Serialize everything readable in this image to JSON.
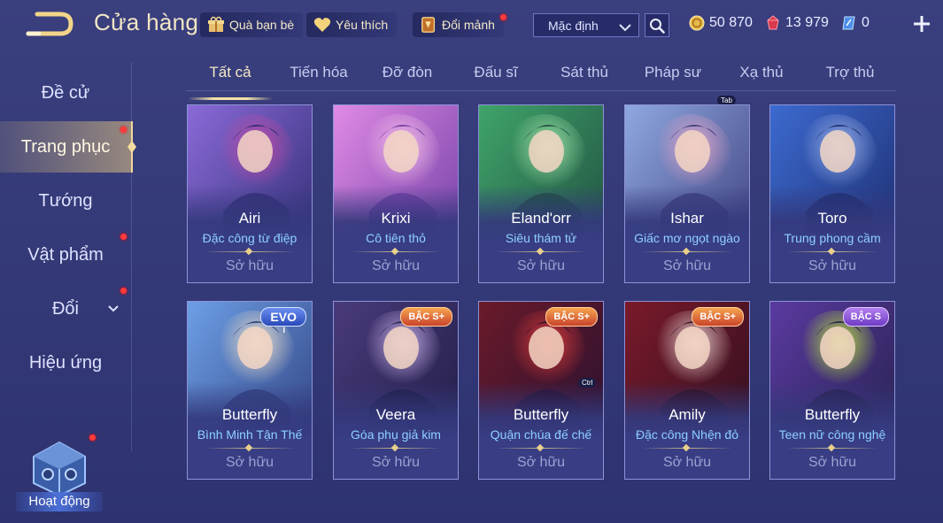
{
  "header": {
    "title": "Cửa hàng",
    "chips": [
      {
        "label": "Quà bạn bè",
        "icon": "gift-icon"
      },
      {
        "label": "Yêu thích",
        "icon": "heart-icon"
      },
      {
        "label": "Đổi mảnh",
        "icon": "shard-card-icon"
      }
    ],
    "sort": {
      "selected": "Mặc định"
    },
    "currencies": [
      {
        "icon": "gold-coin-icon",
        "value": "50 870",
        "color": "#e8b84a"
      },
      {
        "icon": "ruby-icon",
        "value": "13 979",
        "color": "#e0475a"
      },
      {
        "icon": "voucher-icon",
        "value": "0",
        "color": "#6fb7ff"
      }
    ]
  },
  "tabs": [
    {
      "label": "Tất cả",
      "active": true
    },
    {
      "label": "Tiến hóa"
    },
    {
      "label": "Đỡ đòn"
    },
    {
      "label": "Đấu sĩ"
    },
    {
      "label": "Sát thủ"
    },
    {
      "label": "Pháp sư"
    },
    {
      "label": "Xạ thủ"
    },
    {
      "label": "Trợ thủ"
    }
  ],
  "tab_key_hint": "Tab",
  "sidebar": {
    "items": [
      {
        "label": "Đề cử"
      },
      {
        "label": "Trang phục",
        "active": true,
        "dot": true
      },
      {
        "label": "Tướng"
      },
      {
        "label": "Vật phẩm",
        "dot": true
      },
      {
        "label": "Đổi",
        "dot": true
      },
      {
        "label": "Hiệu ứng"
      }
    ],
    "events_label": "Hoạt động"
  },
  "cards": [
    {
      "hero": "Airi",
      "skin": "Đặc công từ điệp",
      "status": "Sở hữu",
      "colors": [
        "#8a6ad8",
        "#c04aa6",
        "#2c2a6e"
      ]
    },
    {
      "hero": "Krixi",
      "skin": "Cô tiên thỏ",
      "status": "Sở hữu",
      "colors": [
        "#e08ae6",
        "#f3c0e8",
        "#6a3aa0"
      ]
    },
    {
      "hero": "Eland'orr",
      "skin": "Siêu thám tử",
      "status": "Sở hữu",
      "colors": [
        "#3fa46a",
        "#9fe0a8",
        "#1f4a3e"
      ]
    },
    {
      "hero": "Ishar",
      "skin": "Giấc mơ ngọt ngào",
      "status": "Sở hữu",
      "colors": [
        "#8fa8e0",
        "#e4a4c8",
        "#3a3a78"
      ]
    },
    {
      "hero": "Toro",
      "skin": "Trung phong cầm",
      "status": "Sở hữu",
      "colors": [
        "#3c6ad0",
        "#9ab0e8",
        "#1c2a6a"
      ]
    },
    {
      "hero": "Butterfly",
      "skin": "Bình Minh Tận Thế",
      "status": "Sở hữu",
      "badge": "EVO",
      "badge_sub": "I",
      "colors": [
        "#6d9fe6",
        "#f0e0c8",
        "#2c3c7a"
      ]
    },
    {
      "hero": "Veera",
      "skin": "Góa phụ giả kim",
      "status": "Sở hữu",
      "badge": "BẬC S+",
      "colors": [
        "#4a3a7a",
        "#c8b0e8",
        "#1e1c44"
      ]
    },
    {
      "hero": "Butterfly",
      "skin": "Quận chúa đế chế",
      "status": "Sở hữu",
      "badge": "BẬC S+",
      "key_hint": "Ctrl",
      "colors": [
        "#6a1a2a",
        "#d83a3a",
        "#241030"
      ]
    },
    {
      "hero": "Amily",
      "skin": "Đặc công Nhện đỏ",
      "status": "Sở hữu",
      "badge": "BẬC S+",
      "colors": [
        "#7a1a2a",
        "#e8d0d0",
        "#2a0e1e"
      ]
    },
    {
      "hero": "Butterfly",
      "skin": "Teen nữ công nghệ",
      "status": "Sở hữu",
      "badge": "BẬC S",
      "colors": [
        "#5a3aa0",
        "#b8e040",
        "#24204a"
      ]
    }
  ]
}
